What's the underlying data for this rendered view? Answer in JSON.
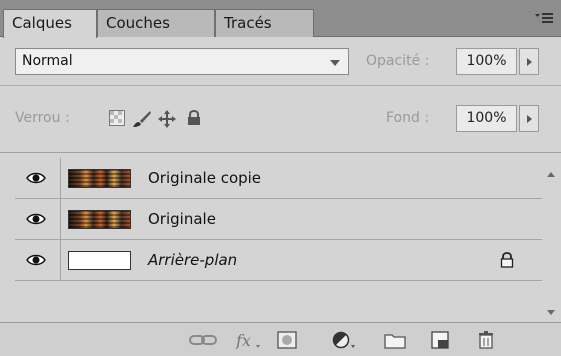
{
  "tabs": [
    {
      "label": "Calques",
      "active": true
    },
    {
      "label": "Couches",
      "active": false
    },
    {
      "label": "Tracés",
      "active": false
    }
  ],
  "blend_mode": {
    "value": "Normal"
  },
  "opacity": {
    "label": "Opacité :",
    "value": "100%"
  },
  "lock": {
    "label": "Verrou :"
  },
  "fill": {
    "label": "Fond :",
    "value": "100%"
  },
  "layers": [
    {
      "name": "Originale copie",
      "visible": true,
      "thumbnail": "image",
      "locked": false
    },
    {
      "name": "Originale",
      "visible": true,
      "thumbnail": "image",
      "locked": false
    },
    {
      "name": "Arrière-plan",
      "visible": true,
      "thumbnail": "white",
      "locked": true
    }
  ],
  "icons": {
    "panel_menu": "panel-menu-icon",
    "lock_transparent": "lock-transparent-pixels-icon",
    "lock_image": "lock-image-pixels-icon",
    "lock_position": "lock-position-icon",
    "lock_all": "lock-all-icon",
    "bottom": [
      "link-layers-icon",
      "layer-style-fx-icon",
      "add-mask-icon",
      "adjustment-layer-icon",
      "new-group-icon",
      "new-layer-icon",
      "trash-icon"
    ]
  },
  "colors": {
    "panel": "#d4d4d4",
    "tabbar": "#8d8d8d"
  }
}
